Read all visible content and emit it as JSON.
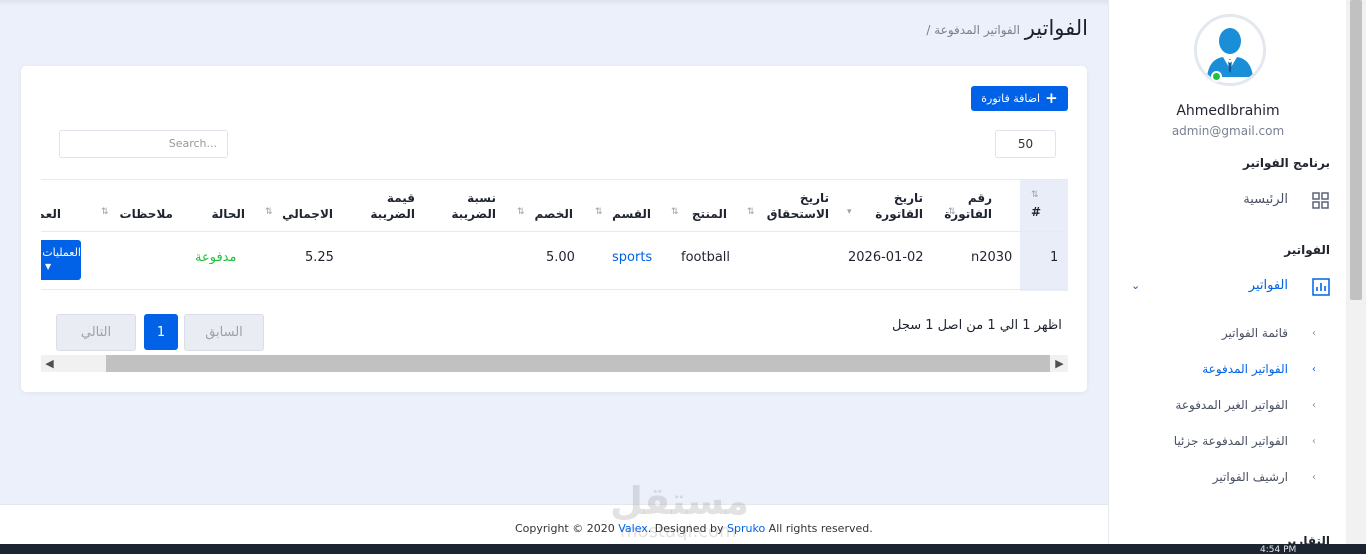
{
  "page": {
    "title": "الفواتير",
    "breadcrumb": "/ الفواتير المدفوعة"
  },
  "toolbar": {
    "add_label": "اضافة فاتورة"
  },
  "table_controls": {
    "length_value": "50",
    "search_placeholder": "Search..."
  },
  "table": {
    "columns": [
      "#",
      "رقم الفاتورة",
      "تاريخ القاتورة",
      "تاريخ الاستحقاق",
      "المنتج",
      "القسم",
      "الخصم",
      "نسبة الضريبة",
      "قيمة الضريبة",
      "الاجمالي",
      "الحالة",
      "ملاحظات",
      "العمليات"
    ],
    "rows": [
      {
        "num": "1",
        "invoice": "n2030",
        "invoice_date": "2026-01-02",
        "due_date": "",
        "product": "football",
        "section": "sports",
        "discount": "5.00",
        "tax_rate": "",
        "tax_value": "",
        "total": "5.25",
        "status": "مدفوعة",
        "notes": "",
        "ops": "العمليات"
      }
    ]
  },
  "pagination": {
    "info": "اظهر 1 الي 1 من اصل 1 سجل",
    "prev": "السابق",
    "current": "1",
    "next": "التالي"
  },
  "footer": {
    "pre": "Copyright © 2020 ",
    "brand": "Valex",
    "mid": ". Designed by ",
    "designer": "Spruko",
    "post": " All rights reserved."
  },
  "watermark": {
    "main": "مستقل",
    "sub": "mostaql.com"
  },
  "sidebar": {
    "user_name": "AhmedIbrahim",
    "user_email": "admin@gmail.com",
    "section_main": "برنامج الفواتير",
    "home": "الرئيسية",
    "section_invoices": "الفواتير",
    "invoices": "الفواتير",
    "sub_items": [
      "قائمة الفواتير",
      "الفواتير المدفوعة",
      "الفواتير الغير المدفوعة",
      "الفواتير المدفوعة جزئيا",
      "ارشيف الفواتير"
    ],
    "section_reports": "التقارير"
  },
  "taskbar": {
    "time": "4:54 PM"
  },
  "colors": {
    "primary": "#0162e8",
    "paid": "#22c03c",
    "link": "#0162e8"
  }
}
